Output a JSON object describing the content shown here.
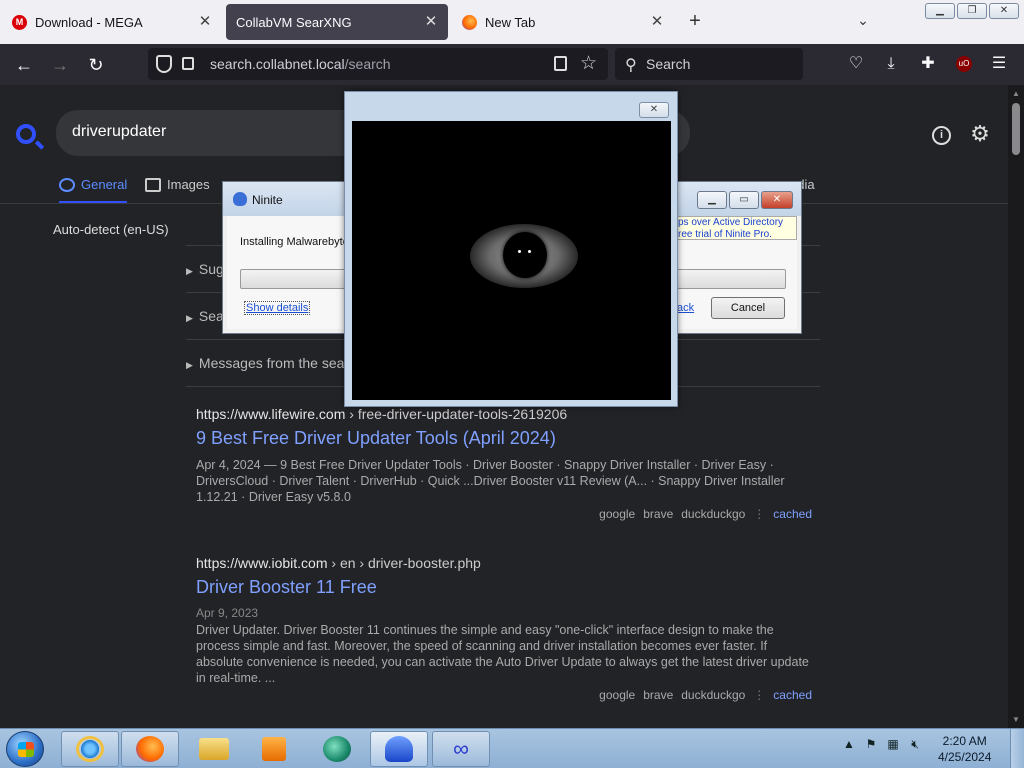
{
  "browser": {
    "tabs": [
      {
        "title": "Download - MEGA",
        "active": false
      },
      {
        "title": "CollabVM SearXNG",
        "active": true
      },
      {
        "title": "New Tab",
        "active": false
      }
    ],
    "url_host": "search.collabnet.local",
    "url_path": "/search",
    "search_placeholder": "Search"
  },
  "search": {
    "query": "driverupdater",
    "categories": [
      {
        "label": "General",
        "icon": "search-icon",
        "active": true
      },
      {
        "label": "Images",
        "icon": "image-icon",
        "active": false
      },
      {
        "label": "edia",
        "icon": "",
        "active": false
      }
    ],
    "language": "Auto-detect (en-US)",
    "accordions": [
      "Sug",
      "Sea",
      "Messages from the sea"
    ]
  },
  "results": [
    {
      "url_host": "https://www.lifewire.com",
      "url_path": " › free-driver-updater-tools-2619206",
      "title": "9 Best Free Driver Updater Tools (April 2024)",
      "date": "",
      "snippet": "Apr 4, 2024 — 9 Best Free Driver Updater Tools · Driver Booster · Snappy Driver Installer · Driver Easy · DriversCloud · Driver Talent · DriverHub · Quick ...Driver Booster v11 Review (A... · Snappy Driver Installer 1.12.21 · Driver Easy v5.8.0",
      "engines": [
        "google",
        "brave",
        "duckduckgo"
      ],
      "cached": "cached"
    },
    {
      "url_host": "https://www.iobit.com",
      "url_path": " › en › driver-booster.php",
      "title": "Driver Booster 11 Free",
      "date": "Apr 9, 2023",
      "snippet": "Driver Updater. Driver Booster 11 continues the simple and easy \"one-click\" interface design to make the process simple and fast. Moreover, the speed of scanning and driver installation becomes ever faster. If absolute convenience is needed, you can activate the Auto Driver Update to always get the latest driver update in real-time. ...",
      "engines": [
        "google",
        "brave",
        "duckduckgo"
      ],
      "cached": "cached"
    }
  ],
  "ninite": {
    "title": "Ninite",
    "installing": "Installing Malwarebyte",
    "ad_line1": "ps over Active Directory",
    "ad_line2": "ree trial of Ninite Pro.",
    "show_details": "Show details",
    "back": "ack",
    "cancel": "Cancel",
    "progress": 0
  },
  "popup": {
    "close": "✕"
  },
  "taskbar": {
    "apps": [
      "internet-explorer",
      "firefox",
      "file-explorer",
      "media-player",
      "app-green",
      "ninite",
      "collabvm"
    ],
    "time": "2:20 AM",
    "date": "4/25/2024"
  },
  "colors": {
    "accent": "#3050ff",
    "link": "#7fa0ff",
    "page_bg": "#222327"
  }
}
